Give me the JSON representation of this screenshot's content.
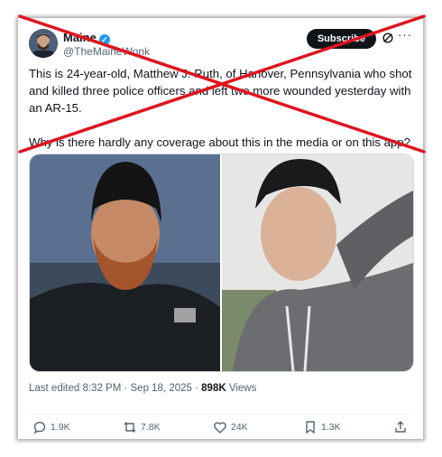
{
  "post": {
    "author_name": "Maine",
    "author_handle": "@TheMaineWonk",
    "subscribe_label": "Subscribe",
    "more_label": "···",
    "text_p1": "This is 24-year-old, Matthew J. Ruth, of Hanover, Pennsylvania who shot and killed three police officers and left two more wounded yesterday with an AR-15.",
    "text_p2": "Why is there hardly any coverage about this in the media or on this app?",
    "timestamp": "Last edited 8:32 PM · Sep 18, 2025 · ",
    "views_count": "898K",
    "views_label": " Views"
  },
  "actions": {
    "replies": "1.9K",
    "reposts": "7.8K",
    "likes": "24K",
    "bookmarks": "1.3K"
  },
  "colors": {
    "cross": "#e0141e",
    "verified": "#1d9bf0",
    "muted": "#536471"
  },
  "icons": [
    "verified-icon",
    "grok-icon",
    "more-icon",
    "reply-icon",
    "repost-icon",
    "like-icon",
    "bookmark-icon",
    "share-icon"
  ]
}
